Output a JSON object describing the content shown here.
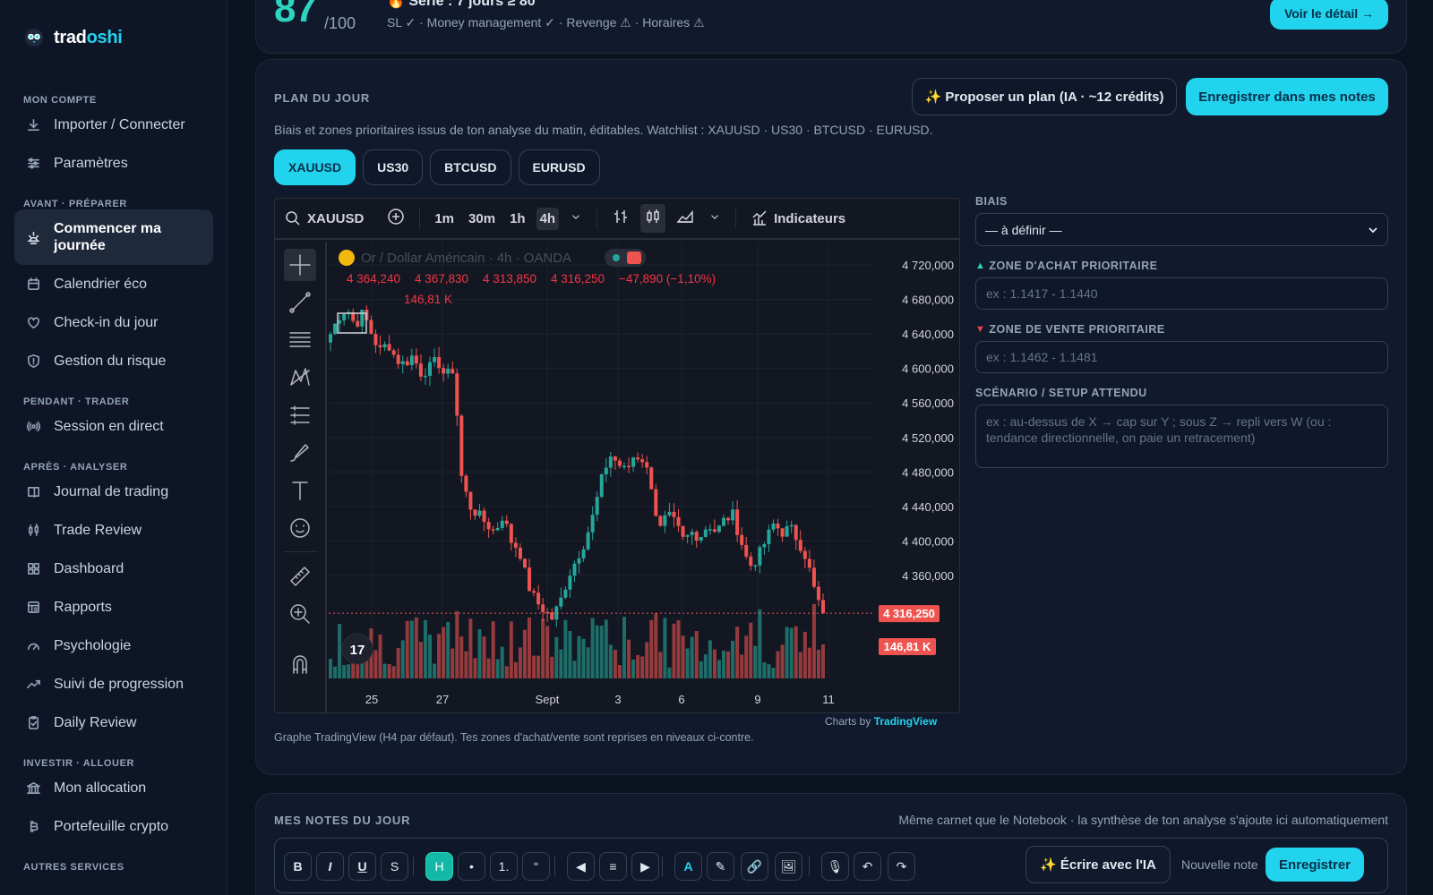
{
  "brand": {
    "name_part1": "trad",
    "name_part2": "oshi"
  },
  "sidebar": {
    "sections": [
      {
        "label": "MON COMPTE",
        "items": [
          {
            "label": "Importer / Connecter",
            "icon": "download-icon"
          },
          {
            "label": "Paramètres",
            "icon": "sliders-icon"
          }
        ]
      },
      {
        "label": "AVANT · PRÉPARER",
        "items": [
          {
            "label": "Commencer ma journée",
            "icon": "sunrise-icon",
            "active": true
          },
          {
            "label": "Calendrier éco",
            "icon": "calendar-icon"
          },
          {
            "label": "Check-in du jour",
            "icon": "heart-icon"
          },
          {
            "label": "Gestion du risque",
            "icon": "shield-icon"
          }
        ]
      },
      {
        "label": "PENDANT · TRADER",
        "items": [
          {
            "label": "Session en direct",
            "icon": "broadcast-icon"
          }
        ]
      },
      {
        "label": "APRÈS · ANALYSER",
        "items": [
          {
            "label": "Journal de trading",
            "icon": "book-icon"
          },
          {
            "label": "Trade Review",
            "icon": "candles-icon"
          },
          {
            "label": "Dashboard",
            "icon": "grid-icon"
          },
          {
            "label": "Rapports",
            "icon": "report-icon"
          },
          {
            "label": "Psychologie",
            "icon": "gauge-icon"
          },
          {
            "label": "Suivi de progression",
            "icon": "trending-up-icon"
          },
          {
            "label": "Daily Review",
            "icon": "clipboard-check-icon"
          }
        ]
      },
      {
        "label": "INVESTIR · ALLOUER",
        "items": [
          {
            "label": "Mon allocation",
            "icon": "bank-icon"
          },
          {
            "label": "Portefeuille crypto",
            "icon": "bitcoin-icon"
          }
        ]
      },
      {
        "label": "AUTRES SERVICES",
        "items": []
      }
    ]
  },
  "score": {
    "value": "87",
    "denominator": "/100",
    "streak": "🔥 Série : 7 jours ≥ 80",
    "checks": "SL ✓ · Money management ✓ · Revenge ⚠ · Horaires ⚠",
    "detail_button": "Voir le détail →"
  },
  "plan": {
    "title": "PLAN DU JOUR",
    "propose_button": "✨ Proposer un plan (IA · ~12 crédits)",
    "save_button": "Enregistrer dans mes notes",
    "description": "Biais et zones prioritaires issus de ton analyse du matin, éditables. Watchlist : XAUUSD · US30 · BTCUSD · EURUSD.",
    "tabs": [
      "XAUUSD",
      "US30",
      "BTCUSD",
      "EURUSD"
    ],
    "active_tab": "XAUUSD",
    "chart_credit_prefix": "Charts by ",
    "chart_credit_brand": "TradingView",
    "chart_caption": "Graphe TradingView (H4 par défaut). Tes zones d'achat/vente sont reprises en niveaux ci-contre."
  },
  "tv": {
    "symbol": "XAUUSD",
    "timeframes": [
      "1m",
      "30m",
      "1h",
      "4h"
    ],
    "active_timeframe": "4h",
    "indicators_label": "Indicateurs",
    "legend_title": "Or / Dollar Américain · 4h · OANDA",
    "ohlc": [
      "4 364,240",
      "4 367,830",
      "4 313,850",
      "4 316,250",
      "−47,890 (−1,10%)"
    ],
    "volume_label": "146,81 K",
    "price_badge": "4 316,250",
    "volume_badge": "146,81 K",
    "y_ticks": [
      "4 720,000",
      "4 680,000",
      "4 640,000",
      "4 600,000",
      "4 560,000",
      "4 520,000",
      "4 480,000",
      "4 440,000",
      "4 400,000",
      "4 360,000"
    ],
    "x_ticks": [
      "25",
      "27",
      "Sept",
      "3",
      "6",
      "9",
      "11"
    ],
    "colors": {
      "up": "#26a69a",
      "down": "#ef5350",
      "bg": "#131722",
      "grid": "#1e222d"
    }
  },
  "chart_data": {
    "type": "candlestick",
    "title": "Or / Dollar Américain · 4h · OANDA",
    "ylim": [
      4290,
      4740
    ],
    "close_path": [
      4640,
      4660,
      4670,
      4650,
      4665,
      4640,
      4620,
      4630,
      4610,
      4605,
      4615,
      4595,
      4600,
      4610,
      4590,
      4600,
      4470,
      4440,
      4430,
      4420,
      4410,
      4430,
      4400,
      4390,
      4350,
      4330,
      4320,
      4310,
      4330,
      4360,
      4380,
      4400,
      4430,
      4470,
      4500,
      4490,
      4480,
      4500,
      4495,
      4470,
      4410,
      4430,
      4420,
      4400,
      4410,
      4405,
      4420,
      4410,
      4425,
      4430,
      4400,
      4370,
      4380,
      4400,
      4420,
      4410,
      4415,
      4400,
      4380,
      4340,
      4316
    ],
    "last_price": 4316.25
  },
  "form": {
    "bias_label": "BIAIS",
    "bias_value": "— à définir —",
    "buy_zone_label": "ZONE D'ACHAT PRIORITAIRE",
    "buy_zone_placeholder": "ex : 1.1417 - 1.1440",
    "sell_zone_label": "ZONE DE VENTE PRIORITAIRE",
    "sell_zone_placeholder": "ex : 1.1462 - 1.1481",
    "scenario_label": "SCÉNARIO / SETUP ATTENDU",
    "scenario_placeholder": "ex : au-dessus de X → cap sur Y ; sous Z → repli vers W (ou : tendance directionnelle, on paie un retracement)"
  },
  "notes": {
    "title": "MES NOTES DU JOUR",
    "subtitle": "Même carnet que le Notebook · la synthèse de ton analyse s'ajoute ici automatiquement",
    "toolbar": [
      "B",
      "I",
      "U",
      "S",
      "H",
      "•",
      "1.",
      "“",
      "◀",
      "≡",
      "▶",
      "A",
      "✎",
      "🔗",
      "🖼",
      "🎙",
      "↶",
      "↷"
    ],
    "write_ai_button": "✨ Écrire avec l'IA",
    "new_note": "Nouvelle note",
    "save_button": "Enregistrer"
  }
}
